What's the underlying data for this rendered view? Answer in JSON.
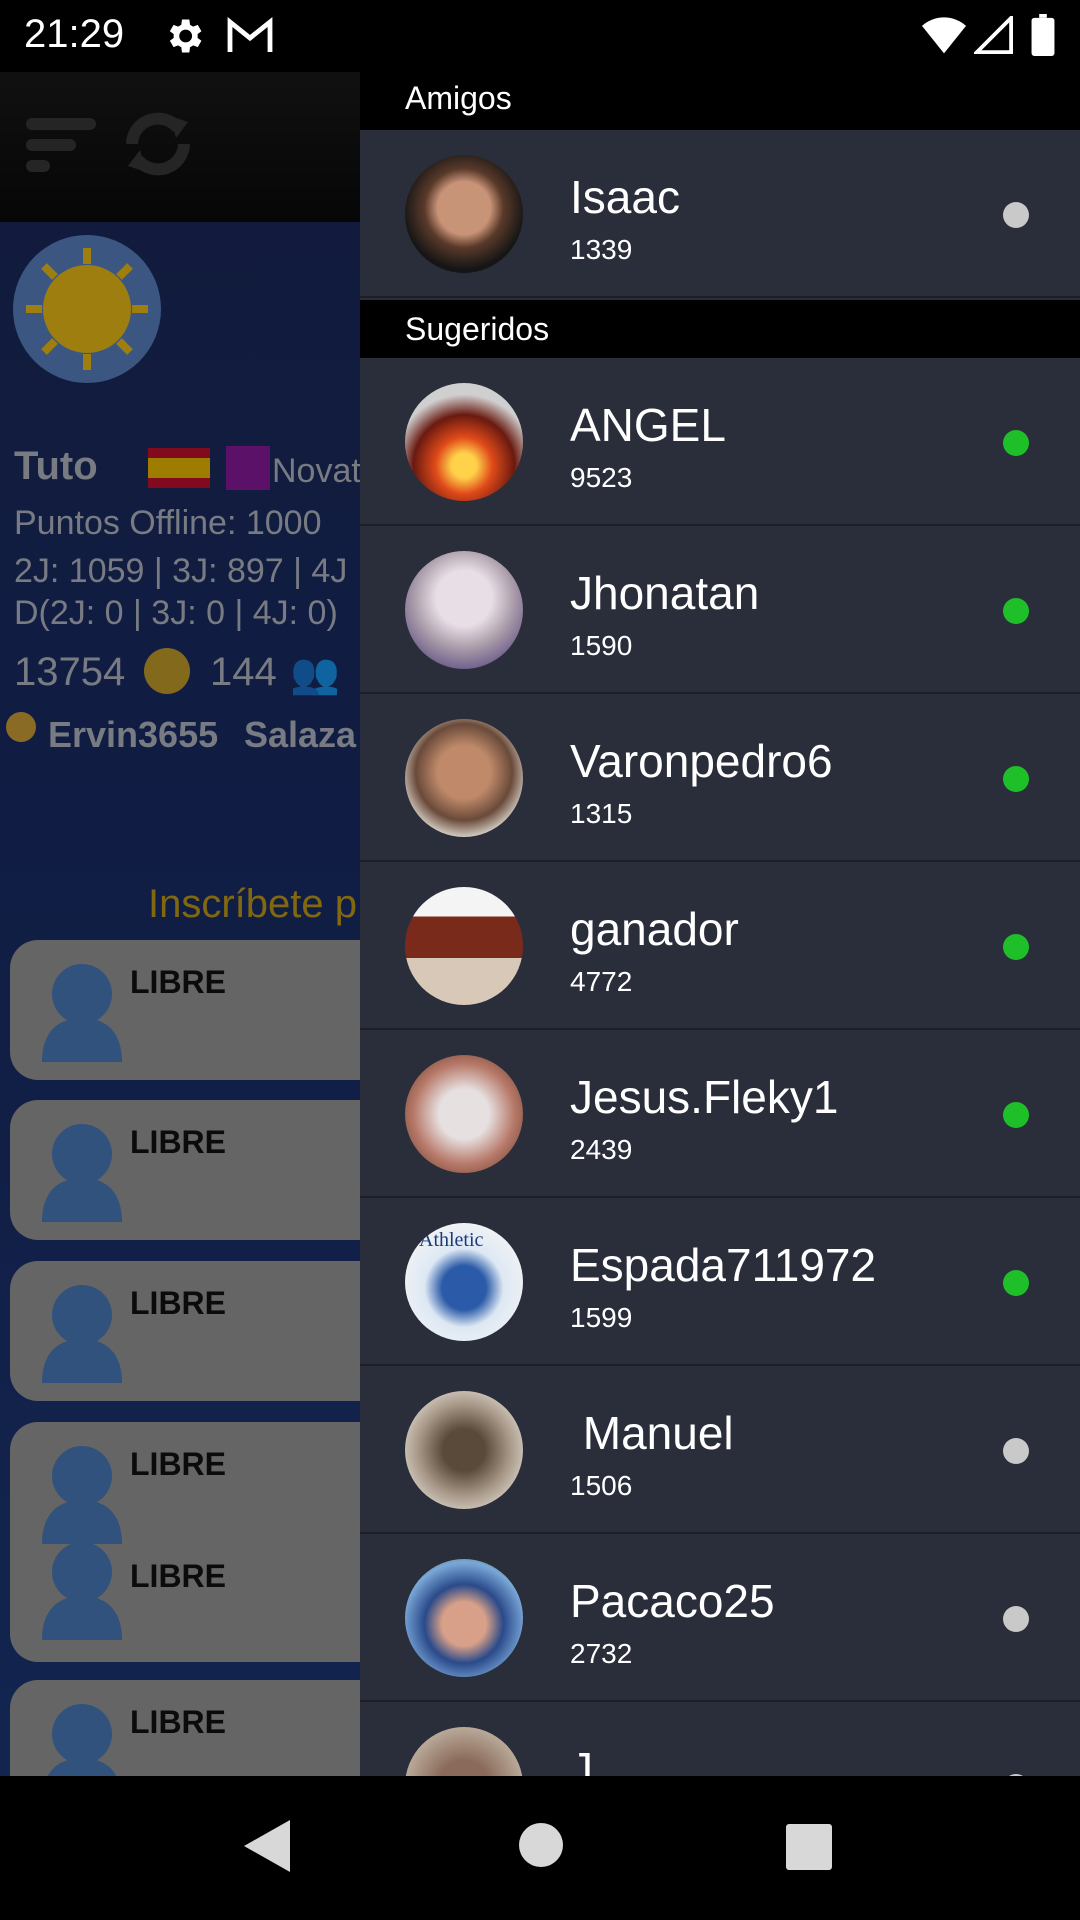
{
  "status_bar": {
    "time": "21:29",
    "icons": [
      "gear-icon",
      "gmail-icon",
      "wifi-icon",
      "signal-icon",
      "battery-icon"
    ]
  },
  "background": {
    "player_name": "Tuto",
    "rank": "Novat",
    "offline_points": "Puntos Offline: 1000",
    "scores_line": "2J: 1059 | 3J: 897 | 4J",
    "d_line": "D(2J: 0 | 3J: 0 | 4J: 0)",
    "coins": "13754",
    "friends_count": "144",
    "medal_user": "Ervin3655",
    "medal_user2": "Salaza",
    "signup": "Inscríbete p",
    "slots": [
      "LIBRE",
      "LIBRE",
      "LIBRE",
      "LIBRE",
      "LIBRE",
      "LIBRE"
    ]
  },
  "drawer": {
    "friends_header": "Amigos",
    "friends": [
      {
        "name": "Isaac",
        "score": "1339",
        "online": false
      }
    ],
    "suggested_header": "Sugeridos",
    "suggested": [
      {
        "name": "ANGEL",
        "score": "9523",
        "online": true
      },
      {
        "name": "Jhonatan",
        "score": "1590",
        "online": true
      },
      {
        "name": "Varonpedro6",
        "score": "1315",
        "online": true
      },
      {
        "name": "ganador",
        "score": "4772",
        "online": true
      },
      {
        "name": "Jesus.Fleky1",
        "score": "2439",
        "online": true
      },
      {
        "name": "Espada711972",
        "score": "1599",
        "online": true
      },
      {
        "name": " Manuel",
        "score": "1506",
        "online": false
      },
      {
        "name": "Pacaco25",
        "score": "2732",
        "online": false
      },
      {
        "name": "J",
        "score": "",
        "online": false
      }
    ],
    "avatar_badge_text": "Athletic"
  },
  "colors": {
    "online": "#1fbf2a",
    "offline": "#c9c9c9",
    "drawer_bg": "#2a2e3a",
    "header_bg": "#000000"
  }
}
